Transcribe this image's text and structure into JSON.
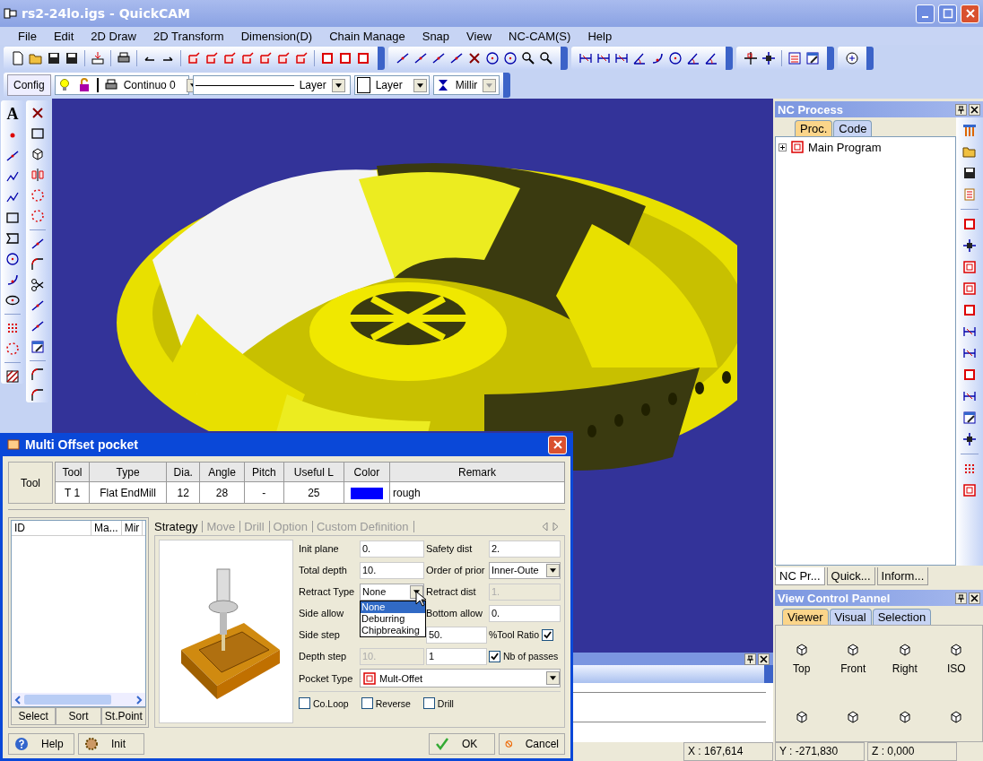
{
  "window": {
    "title": "rs2-24lo.igs - QuickCAM"
  },
  "menu": [
    "File",
    "Edit",
    "2D Draw",
    "2D Transform",
    "Dimension(D)",
    "Chain Manage",
    "Snap",
    "View",
    "NC-CAM(S)",
    "Help"
  ],
  "property_bar": {
    "config_button": "Config",
    "line_style": "Continuo 0",
    "line_layer": "Layer",
    "color_layer": "Layer",
    "mode": "Millir"
  },
  "left_toolbar": {
    "text_tool": "A"
  },
  "nc_process": {
    "title": "NC Process",
    "tabs": [
      {
        "label": "Proc.",
        "selected": true
      },
      {
        "label": "Code",
        "selected": false
      }
    ],
    "tree": [
      {
        "label": "Main Program",
        "expanded": false
      }
    ],
    "bottom_tabs": [
      {
        "label": "NC Pr...",
        "selected": true
      },
      {
        "label": "Quick...",
        "selected": false
      },
      {
        "label": "Inform...",
        "selected": false
      }
    ]
  },
  "view_control": {
    "title": "View Control Pannel",
    "tabs": [
      {
        "label": "Viewer",
        "selected": true
      },
      {
        "label": "Visual",
        "selected": false
      },
      {
        "label": "Selection",
        "selected": false
      }
    ],
    "views": [
      "Top",
      "Front",
      "Right",
      "ISO"
    ]
  },
  "status_bar": {
    "x": "X : 167,614",
    "y": "Y : -271,830",
    "z": "Z : 0,000"
  },
  "dialog": {
    "title": "Multi Offset pocket",
    "tool_button": "Tool",
    "tool_table": {
      "columns": [
        "Tool",
        "Type",
        "Dia.",
        "Angle",
        "Pitch",
        "Useful L",
        "Color",
        "Remark"
      ],
      "rows": [
        {
          "tool": "T 1",
          "type": "Flat EndMill",
          "dia": "12",
          "angle": "28",
          "pitch": "-",
          "useful": "25",
          "color": "#0000ff",
          "remark": "rough"
        }
      ]
    },
    "list": {
      "columns": [
        "ID",
        "Ma...",
        "Mir"
      ],
      "buttons": [
        "Select",
        "Sort",
        "St.Point"
      ]
    },
    "tabs": [
      {
        "label": "Strategy",
        "selected": true
      },
      {
        "label": "Move",
        "selected": false
      },
      {
        "label": "Drill",
        "selected": false
      },
      {
        "label": "Option",
        "selected": false
      },
      {
        "label": "Custom Definition",
        "selected": false
      }
    ],
    "rows": [
      [
        {
          "kind": "label",
          "text": "Init plane"
        },
        {
          "kind": "field",
          "value": "0.",
          "disabled": false
        },
        {
          "kind": "label",
          "text": "Safety dist"
        },
        {
          "kind": "field",
          "value": "2.",
          "disabled": false
        }
      ],
      [
        {
          "kind": "label",
          "text": "Total depth"
        },
        {
          "kind": "field",
          "value": "10.",
          "disabled": false
        },
        {
          "kind": "label",
          "text": "Order of prior"
        },
        {
          "kind": "select",
          "value": "Inner-Oute"
        }
      ],
      [
        {
          "kind": "label",
          "text": "Retract Type"
        },
        {
          "kind": "select",
          "value": "None",
          "open": true,
          "options": [
            {
              "label": "None",
              "selected": true
            },
            {
              "label": "Deburring",
              "selected": false
            },
            {
              "label": "Chipbreaking",
              "selected": false
            }
          ]
        },
        {
          "kind": "label",
          "text": "Retract dist"
        },
        {
          "kind": "field",
          "value": "1.",
          "disabled": true
        }
      ],
      [
        {
          "kind": "label",
          "text": "Side allow"
        },
        {
          "kind": "blank"
        },
        {
          "kind": "label",
          "text": "Bottom allow"
        },
        {
          "kind": "field",
          "value": "0.",
          "disabled": false
        }
      ],
      [
        {
          "kind": "label",
          "text": "Side step"
        },
        {
          "kind": "blank"
        },
        {
          "kind": "field",
          "value": "50.",
          "disabled": false
        },
        {
          "kind": "check_after",
          "label": "%Tool Ratio",
          "checked": true
        }
      ],
      [
        {
          "kind": "label",
          "text": "Depth step"
        },
        {
          "kind": "field",
          "value": "10.",
          "disabled": true
        },
        {
          "kind": "field",
          "value": "1",
          "disabled": false
        },
        {
          "kind": "check",
          "label": "Nb of passes",
          "checked": true
        }
      ]
    ],
    "pocket_type": {
      "label": "Pocket Type",
      "value": "Mult-Offet"
    },
    "options": [
      {
        "label": "Co.Loop",
        "checked": false
      },
      {
        "label": "Reverse",
        "checked": false
      },
      {
        "label": "Drill",
        "checked": false
      }
    ],
    "buttons": [
      {
        "label": "Help",
        "kind": "help"
      },
      {
        "label": "Init",
        "kind": "init"
      },
      {
        "label": "OK",
        "kind": "ok"
      },
      {
        "label": "Cancel",
        "kind": "cancel"
      }
    ]
  }
}
